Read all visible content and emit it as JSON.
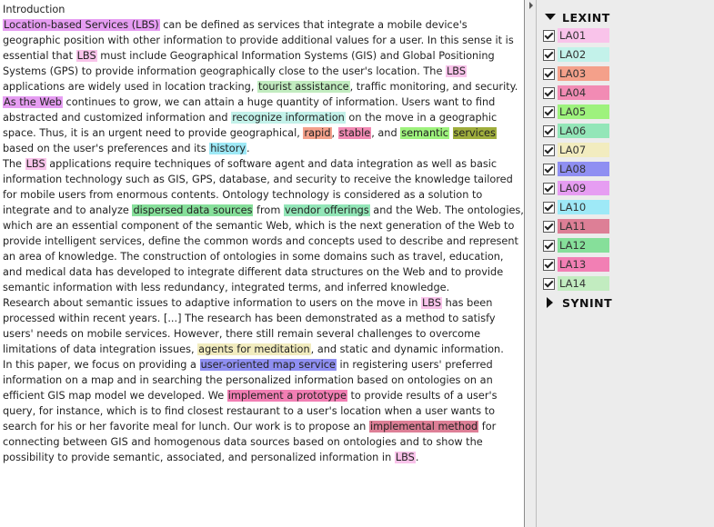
{
  "document": {
    "title": "Introduction",
    "paragraphs": [
      [
        {
          "text": "Location-based Services (LBS)",
          "hl": "LA09"
        },
        {
          "text": " can be defined as services that integrate a mobile device's geographic position with other information to provide additional values for a user. In this sense it is essential that "
        },
        {
          "text": "LBS",
          "hl": "LA01"
        },
        {
          "text": " must include Geographical Information Systems (GIS) and Global Positioning Systems (GPS) to provide information geographically close to the user's location. The "
        },
        {
          "text": "LBS",
          "hl": "LA01"
        },
        {
          "text": " applications are widely used in location tracking, "
        },
        {
          "text": "tourist assistance",
          "hl": "LA14"
        },
        {
          "text": ", traffic monitoring, and security."
        }
      ],
      [
        {
          "text": "As the Web",
          "hl": "LA09"
        },
        {
          "text": " continues to grow, we can attain a huge quantity of information. Users want to find abstracted and customized information and "
        },
        {
          "text": "recognize information",
          "hl": "LA02"
        },
        {
          "text": " on the move in a geographic space. Thus, it is an urgent need to provide geographical, "
        },
        {
          "text": "rapid",
          "hl": "LA03"
        },
        {
          "text": ", "
        },
        {
          "text": "stable",
          "hl": "LA04"
        },
        {
          "text": ", and "
        },
        {
          "text": "semantic",
          "hl": "LA05"
        },
        {
          "text": " "
        },
        {
          "text": "services",
          "hl": "LAOLIVE"
        },
        {
          "text": " based on the user's preferences and its "
        },
        {
          "text": "history",
          "hl": "LA10"
        },
        {
          "text": "."
        }
      ],
      [
        {
          "text": "The "
        },
        {
          "text": "LBS",
          "hl": "LA01"
        },
        {
          "text": " applications require techniques of software agent and data integration as well as basic information technology such as GIS, GPS, database, and security to receive the knowledge tailored for mobile users from enormous contents. Ontology technology is considered as a solution to integrate and to analyze "
        },
        {
          "text": "dispersed data sources",
          "hl": "LA12"
        },
        {
          "text": " from "
        },
        {
          "text": "vendor offerings",
          "hl": "LA06"
        },
        {
          "text": " and the Web. The ontologies, which are an essential component of the semantic Web, which is the next generation of the Web to provide intelligent services, define the common words and concepts used to describe and represent an area of knowledge. The construction of ontologies in some domains such as travel, education, and medical data has developed to integrate different data structures on the Web and to provide semantic information with less redundancy, integrated terms, and inferred knowledge."
        }
      ],
      [
        {
          "text": "Research about semantic issues to adaptive information to users on the move in "
        },
        {
          "text": "LBS",
          "hl": "LA01"
        },
        {
          "text": " has been processed within recent years. [...] The research has been demonstrated as a method to satisfy users' needs on mobile services. However, there still remain several challenges to overcome limitations of data integration issues, "
        },
        {
          "text": "agents for meditation",
          "hl": "LA07"
        },
        {
          "text": ", and static and dynamic information."
        }
      ],
      [
        {
          "text": "In this paper, we focus on providing a "
        },
        {
          "text": "user-oriented map service",
          "hl": "LA08"
        },
        {
          "text": " in registering users' preferred information on a map and in searching the personalized information based on ontologies on an efficient GIS map model we developed. We "
        },
        {
          "text": "implement a prototype",
          "hl": "LA13"
        },
        {
          "text": " to provide results of a user's query, for instance, which is to find closest restaurant to a user's location when a user wants to search for his or her favorite meal for lunch. Our work is to propose an "
        },
        {
          "text": "implemental method",
          "hl": "LA11"
        },
        {
          "text": " for connecting between GIS and homogenous data sources based on ontologies and to show the possibility to provide semantic, associated, and personalized information in "
        },
        {
          "text": "LBS",
          "hl": "LA01"
        },
        {
          "text": "."
        }
      ]
    ]
  },
  "colors": {
    "LA01": "#f9c3ea",
    "LA02": "#c3f2ea",
    "LA03": "#f4a08a",
    "LA04": "#f28bb4",
    "LA05": "#9ef27d",
    "LA06": "#93e6b8",
    "LA07": "#f2ecbf",
    "LA08": "#8f8ff2",
    "LA09": "#e69df2",
    "LA10": "#9ee9f7",
    "LA11": "#dd7f96",
    "LA12": "#86df9a",
    "LA13": "#f27fb4",
    "LA14": "#c2ecc0",
    "LAOLIVE": "#9fae3c"
  },
  "sidebar": {
    "groups": [
      {
        "label": "LEXINT",
        "expanded": true,
        "icon": "triangle-down-icon"
      },
      {
        "label": "SYNINT",
        "expanded": false,
        "icon": "triangle-right-icon"
      }
    ],
    "labels": [
      {
        "id": "LA01",
        "checked": true
      },
      {
        "id": "LA02",
        "checked": true
      },
      {
        "id": "LA03",
        "checked": true
      },
      {
        "id": "LA04",
        "checked": true
      },
      {
        "id": "LA05",
        "checked": true
      },
      {
        "id": "LA06",
        "checked": true
      },
      {
        "id": "LA07",
        "checked": true
      },
      {
        "id": "LA08",
        "checked": true
      },
      {
        "id": "LA09",
        "checked": true
      },
      {
        "id": "LA10",
        "checked": true
      },
      {
        "id": "LA11",
        "checked": true
      },
      {
        "id": "LA12",
        "checked": true
      },
      {
        "id": "LA13",
        "checked": true
      },
      {
        "id": "LA14",
        "checked": true
      }
    ]
  }
}
